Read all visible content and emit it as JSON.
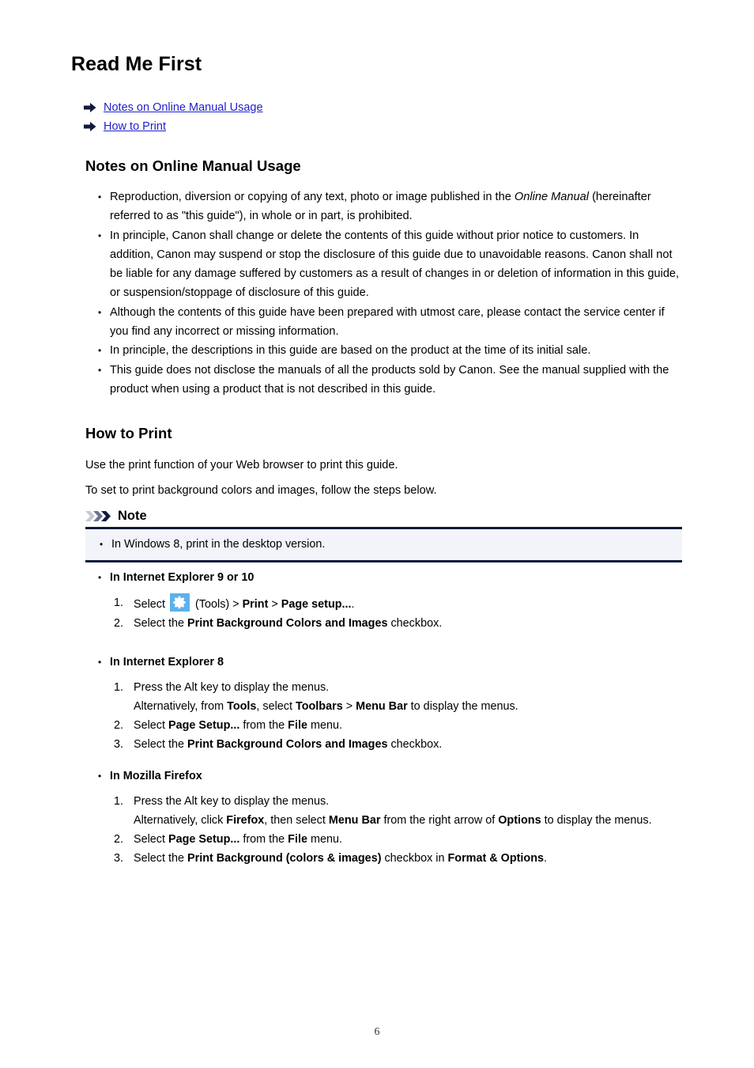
{
  "document": {
    "title": "Read Me First",
    "page_number": "6"
  },
  "toc": {
    "icon": "arrow-right-icon",
    "items": [
      {
        "label": "Notes on Online Manual Usage"
      },
      {
        "label": "How to Print"
      }
    ]
  },
  "notes_section": {
    "heading": "Notes on Online Manual Usage",
    "bullets": [
      {
        "parts": [
          {
            "t": "Reproduction, diversion or copying of any text, photo or image published in the ",
            "s": "normal"
          },
          {
            "t": "Online Manual",
            "s": "italic"
          },
          {
            "t": " (hereinafter referred to as \"this guide\"), in whole or in part, is prohibited.",
            "s": "normal"
          }
        ]
      },
      {
        "parts": [
          {
            "t": "In principle, Canon shall change or delete the contents of this guide without prior notice to customers. In addition, Canon may suspend or stop the disclosure of this guide due to unavoidable reasons. Canon shall not be liable for any damage suffered by customers as a result of changes in or deletion of information in this guide, or suspension/stoppage of disclosure of this guide.",
            "s": "normal"
          }
        ]
      },
      {
        "parts": [
          {
            "t": "Although the contents of this guide have been prepared with utmost care, please contact the service center if you find any incorrect or missing information.",
            "s": "normal"
          }
        ]
      },
      {
        "parts": [
          {
            "t": "In principle, the descriptions in this guide are based on the product at the time of its initial sale.",
            "s": "normal"
          }
        ]
      },
      {
        "parts": [
          {
            "t": "This guide does not disclose the manuals of all the products sold by Canon. See the manual supplied with the product when using a product that is not described in this guide.",
            "s": "normal"
          }
        ]
      }
    ]
  },
  "howto_section": {
    "heading": "How to Print",
    "intro_paragraph": "Use the print function of your Web browser to print this guide.",
    "instruction_paragraph": "To set to print background colors and images, follow the steps below."
  },
  "note_callout": {
    "icon": "triple-chevron-icon",
    "title": "Note",
    "colors": {
      "background": "#f2f4f9",
      "rule": "#111a3d",
      "chevron_light": "#c6c9d4",
      "chevron_mid": "#6d7490",
      "chevron_dark": "#111a3d"
    },
    "items": [
      {
        "text": "In Windows 8, print in the desktop version."
      }
    ]
  },
  "procedures": [
    {
      "name": "ie-9-or-10",
      "heading": "In Internet Explorer 9 or 10",
      "steps": [
        {
          "lines": [
            {
              "parts": [
                {
                  "t": "Select ",
                  "s": "normal"
                },
                {
                  "t": "",
                  "s": "gear-icon"
                },
                {
                  "t": " (Tools) > ",
                  "s": "normal"
                },
                {
                  "t": "Print",
                  "s": "bold"
                },
                {
                  "t": " > ",
                  "s": "normal"
                },
                {
                  "t": "Page setup...",
                  "s": "bold"
                },
                {
                  "t": ".",
                  "s": "normal"
                }
              ]
            }
          ]
        },
        {
          "lines": [
            {
              "parts": [
                {
                  "t": "Select the ",
                  "s": "normal"
                },
                {
                  "t": "Print Background Colors and Images",
                  "s": "bold"
                },
                {
                  "t": " checkbox.",
                  "s": "normal"
                }
              ]
            }
          ]
        }
      ]
    },
    {
      "name": "ie-8",
      "heading": "In Internet Explorer 8",
      "steps": [
        {
          "lines": [
            {
              "parts": [
                {
                  "t": "Press the Alt key to display the menus.",
                  "s": "normal"
                }
              ]
            },
            {
              "parts": [
                {
                  "t": "Alternatively, from ",
                  "s": "normal"
                },
                {
                  "t": "Tools",
                  "s": "bold"
                },
                {
                  "t": ", select ",
                  "s": "normal"
                },
                {
                  "t": "Toolbars",
                  "s": "bold"
                },
                {
                  "t": " > ",
                  "s": "normal"
                },
                {
                  "t": "Menu Bar",
                  "s": "bold"
                },
                {
                  "t": " to display the menus.",
                  "s": "normal"
                }
              ]
            }
          ]
        },
        {
          "lines": [
            {
              "parts": [
                {
                  "t": "Select ",
                  "s": "normal"
                },
                {
                  "t": "Page Setup...",
                  "s": "bold"
                },
                {
                  "t": " from the ",
                  "s": "normal"
                },
                {
                  "t": "File",
                  "s": "bold"
                },
                {
                  "t": " menu.",
                  "s": "normal"
                }
              ]
            }
          ]
        },
        {
          "lines": [
            {
              "parts": [
                {
                  "t": "Select the ",
                  "s": "normal"
                },
                {
                  "t": "Print Background Colors and Images",
                  "s": "bold"
                },
                {
                  "t": " checkbox.",
                  "s": "normal"
                }
              ]
            }
          ]
        }
      ]
    },
    {
      "name": "mozilla-firefox",
      "heading": "In Mozilla Firefox",
      "steps": [
        {
          "lines": [
            {
              "parts": [
                {
                  "t": "Press the Alt key to display the menus.",
                  "s": "normal"
                }
              ]
            },
            {
              "parts": [
                {
                  "t": "Alternatively, click ",
                  "s": "normal"
                },
                {
                  "t": "Firefox",
                  "s": "bold"
                },
                {
                  "t": ", then select ",
                  "s": "normal"
                },
                {
                  "t": "Menu Bar",
                  "s": "bold"
                },
                {
                  "t": " from the right arrow of ",
                  "s": "normal"
                },
                {
                  "t": "Options",
                  "s": "bold"
                },
                {
                  "t": " to display the menus.",
                  "s": "normal"
                }
              ]
            }
          ]
        },
        {
          "lines": [
            {
              "parts": [
                {
                  "t": "Select ",
                  "s": "normal"
                },
                {
                  "t": "Page Setup...",
                  "s": "bold"
                },
                {
                  "t": " from the ",
                  "s": "normal"
                },
                {
                  "t": "File",
                  "s": "bold"
                },
                {
                  "t": " menu.",
                  "s": "normal"
                }
              ]
            }
          ]
        },
        {
          "lines": [
            {
              "parts": [
                {
                  "t": "Select the ",
                  "s": "normal"
                },
                {
                  "t": "Print Background (colors & images)",
                  "s": "bold"
                },
                {
                  "t": " checkbox in ",
                  "s": "normal"
                },
                {
                  "t": "Format & Options",
                  "s": "bold"
                },
                {
                  "t": ".",
                  "s": "normal"
                }
              ]
            }
          ]
        }
      ]
    }
  ]
}
